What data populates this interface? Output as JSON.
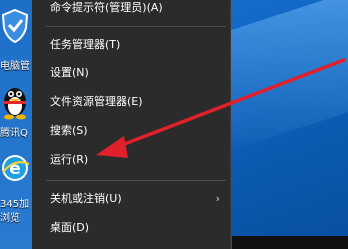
{
  "desktop": {
    "icons": [
      {
        "label": "",
        "icon": "shield-icon"
      },
      {
        "label": "电脑管",
        "icon": "qq-penguin-icon"
      },
      {
        "label": "腾讯Q",
        "icon": "qq-penguin-icon"
      },
      {
        "label": "345加",
        "icon": "browser-e-icon"
      },
      {
        "label": "浏览",
        "icon": ""
      }
    ]
  },
  "start_menu": {
    "items": [
      {
        "label": "命令提示符(管理员)(A)"
      },
      {
        "label": "任务管理器(T)"
      },
      {
        "label": "设置(N)"
      },
      {
        "label": "文件资源管理器(E)"
      },
      {
        "label": "搜索(S)"
      },
      {
        "label": "运行(R)"
      },
      {
        "label": "关机或注销(U)",
        "submenu_icon": "chevron-right-icon",
        "submenu_glyph": "›"
      },
      {
        "label": "桌面(D)"
      }
    ]
  },
  "annotation": {
    "color": "#e0202a",
    "icon": "red-arrow-icon"
  }
}
